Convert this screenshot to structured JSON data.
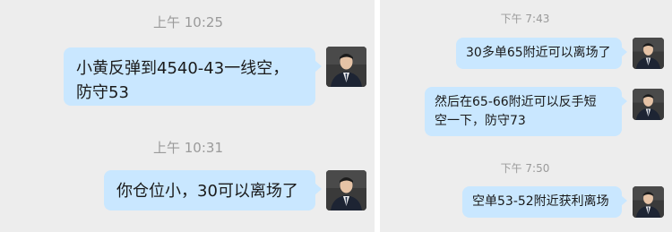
{
  "left_chat": {
    "groups": [
      {
        "time": "上午 10:25",
        "messages": [
          "小黄反弹到4540-43一线空，\n防守53"
        ]
      },
      {
        "time": "上午 10:31",
        "messages": [
          "你仓位小，30可以离场了"
        ]
      }
    ]
  },
  "right_chat": {
    "groups": [
      {
        "time": "下午 7:43",
        "messages": [
          "30多单65附近可以离场了",
          "然后在65-66附近可以反手短\n空一下，防守73"
        ]
      },
      {
        "time": "下午 7:50",
        "messages": [
          "空单53-52附近获利离场"
        ]
      }
    ]
  },
  "colors": {
    "background": "#ededed",
    "bubble": "#c9e7ff",
    "timestamp": "#9a9a9a"
  },
  "avatar_icon": "user-avatar-icon"
}
